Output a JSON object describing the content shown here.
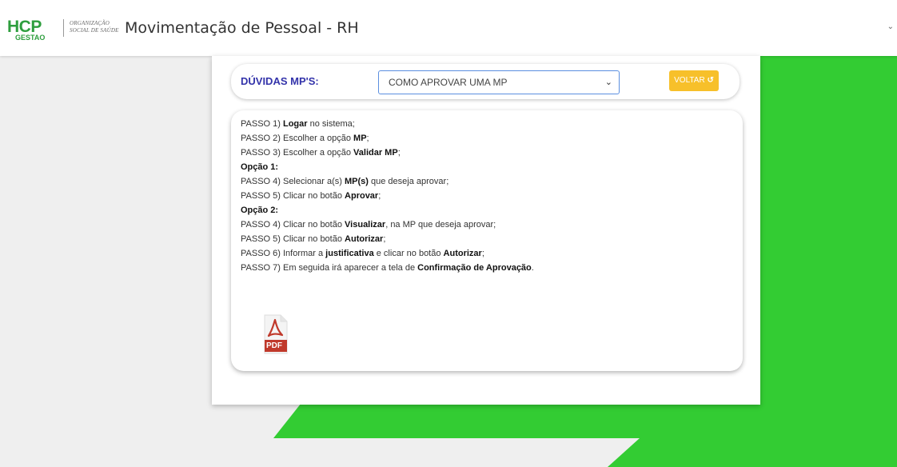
{
  "header": {
    "logo_text": "HCP",
    "logo_sub": "GESTAO",
    "logo_tagline_1": "ORGANIZAÇÃO",
    "logo_tagline_2": "SOCIAL DE SAÚDE",
    "title": "Movimentação de Pessoal - RH"
  },
  "filter": {
    "label": "DÚVIDAS MP'S:",
    "selected": "COMO APROVAR UMA MP",
    "back_label": "VOLTAR"
  },
  "steps": [
    {
      "pre": "PASSO 1) ",
      "bold": "Logar",
      "post": " no sistema;"
    },
    {
      "pre": "PASSO 2) Escolher a opção ",
      "bold": "MP",
      "post": ";"
    },
    {
      "pre": "PASSO 3) Escolher a opção ",
      "bold": "Validar MP",
      "post": ";"
    },
    {
      "pre": "",
      "bold": "Opção 1:",
      "post": ""
    },
    {
      "pre": "PASSO 4) Selecionar a(s) ",
      "bold": "MP(s)",
      "post": " que deseja aprovar;"
    },
    {
      "pre": "PASSO 5) Clicar no botão ",
      "bold": "Aprovar",
      "post": ";"
    },
    {
      "pre": "",
      "bold": "Opção 2:",
      "post": ""
    },
    {
      "pre": "PASSO 4) Clicar no botão ",
      "bold": "Visualizar",
      "post": ", na MP que deseja aprovar;"
    },
    {
      "pre": "PASSO 5) Clicar no botão ",
      "bold": "Autorizar",
      "post": ";"
    },
    {
      "pre": "PASSO 6) Informar a ",
      "bold": "justificativa",
      "post": " e clicar no botão ",
      "bold2": "Autorizar",
      "post2": ";"
    },
    {
      "pre": "PASSO 7) Em seguida irá aparecer a tela de ",
      "bold": "Confirmação de Aprovação",
      "post": "."
    }
  ],
  "pdf_label": "PDF",
  "colors": {
    "green": "#33cc33",
    "accent_blue": "#3333aa",
    "button_yellow": "#f7c02a",
    "pdf_red": "#c0392b"
  }
}
